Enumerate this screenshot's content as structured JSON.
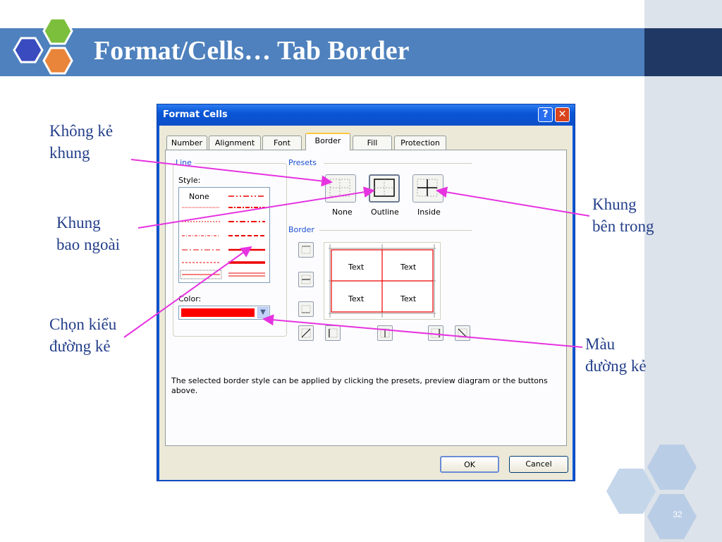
{
  "slide": {
    "title": "Format/Cells… Tab Border",
    "page_number": "32"
  },
  "labels": {
    "no_border": [
      "Không kẻ",
      "khung"
    ],
    "outline": [
      "Khung",
      "bao ngoài"
    ],
    "line_style": [
      "Chọn kiểu",
      "đường kẻ"
    ],
    "inside": [
      "Khung",
      "bên trong"
    ],
    "line_color": [
      "Màu",
      "đường kẻ"
    ]
  },
  "dialog": {
    "title": "Format Cells",
    "tabs": [
      {
        "label": "Number"
      },
      {
        "label": "Alignment"
      },
      {
        "label": "Font"
      },
      {
        "label": "Border"
      },
      {
        "label": "Fill"
      },
      {
        "label": "Protection"
      }
    ],
    "active_tab": "Border",
    "line_group": "Line",
    "style_label": "Style:",
    "none_style": "None",
    "color_label": "Color:",
    "color_value": "#ff0000",
    "presets_label": "Presets",
    "presets": [
      {
        "label": "None"
      },
      {
        "label": "Outline"
      },
      {
        "label": "Inside"
      }
    ],
    "border_label": "Border",
    "preview_cells": [
      "Text",
      "Text",
      "Text",
      "Text"
    ],
    "info_text": "The selected border style can be applied by clicking the presets, preview diagram or the buttons above.",
    "ok_label": "OK",
    "cancel_label": "Cancel"
  },
  "colors": {
    "title_bar": "#4e81bd",
    "accent_dark": "#1f3864",
    "label_text": "#243f8a",
    "arrow": "#e633e0",
    "border_red": "#ff0000"
  }
}
